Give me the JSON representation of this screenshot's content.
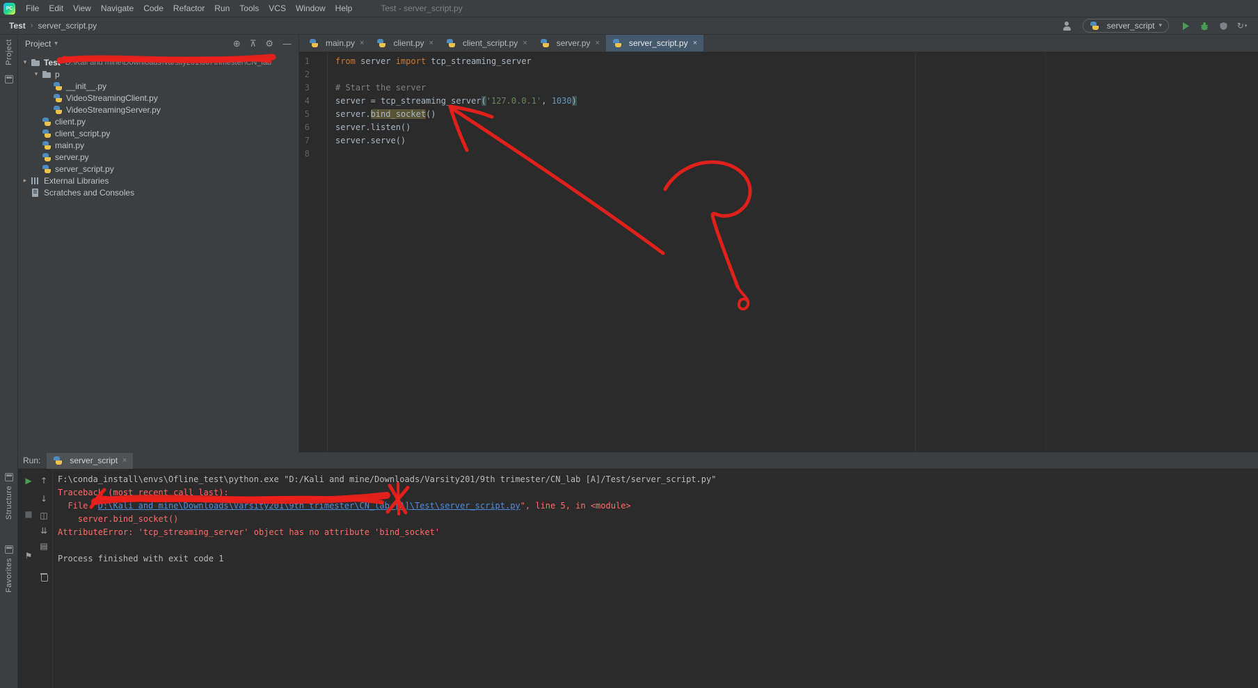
{
  "colors": {
    "annotation_red": "#ed1f1a",
    "panel_bg": "#3c3f41",
    "editor_bg": "#2b2b2b",
    "keyword_orange": "#cc7832",
    "string_green": "#6a8759",
    "number_blue": "#6897bb",
    "comment_gray": "#808080",
    "error_red": "#ff6b68",
    "link_blue": "#4e8ddb",
    "run_green": "#499c54",
    "active_tab_bg": "#45596d"
  },
  "icons": {
    "close": "×",
    "dropdown_caret": "▾",
    "expanded_caret": "▾",
    "collapsed_caret": "▸",
    "locate": "⊕",
    "collapse_all": "⊼",
    "settings_gear": "⚙",
    "hide": "—",
    "rerun": "▶",
    "stop": "■",
    "pin": "⚑",
    "up": "↑",
    "down": "↓",
    "restore_layout": "◫",
    "scroll_end": "⇊",
    "print": "▤",
    "updates": "↻"
  },
  "title_bar": {
    "app_badge": "PC",
    "menus": [
      "File",
      "Edit",
      "View",
      "Navigate",
      "Code",
      "Refactor",
      "Run",
      "Tools",
      "VCS",
      "Window",
      "Help"
    ],
    "window_title": "Test - server_script.py"
  },
  "nav_bar": {
    "breadcrumb_root": "Test",
    "breadcrumb_separator": "›",
    "breadcrumb_file": "server_script.py",
    "run_config": "server_script"
  },
  "stripes": {
    "project": "Project",
    "structure": "Structure",
    "favorites": "Favorites"
  },
  "project_panel": {
    "header_title": "Project",
    "tree": [
      {
        "label": "Test",
        "path": "D:\\Kali and mine\\Downloads\\Varsity201\\9th trimester\\CN_lab [A]\\Test"
      },
      {
        "label": "p"
      },
      {
        "label": "__init__.py"
      },
      {
        "label": "VideoStreamingClient.py"
      },
      {
        "label": "VideoStreamingServer.py"
      },
      {
        "label": "client.py"
      },
      {
        "label": "client_script.py"
      },
      {
        "label": "main.py"
      },
      {
        "label": "server.py"
      },
      {
        "label": "server_script.py"
      },
      {
        "label": "External Libraries"
      },
      {
        "label": "Scratches and Consoles"
      }
    ]
  },
  "editor": {
    "tabs": [
      "main.py",
      "client.py",
      "client_script.py",
      "server.py",
      "server_script.py"
    ],
    "lines": [
      {
        "num": "1",
        "seg": [
          "from",
          " server ",
          "import",
          " tcp_streaming_server"
        ]
      },
      {
        "num": "2",
        "seg": []
      },
      {
        "num": "3",
        "seg": [
          "# Start the server"
        ]
      },
      {
        "num": "4",
        "seg": [
          "server = tcp_streaming_server",
          "(",
          "'127.0.0.1'",
          ", ",
          "1030",
          ")"
        ]
      },
      {
        "num": "5",
        "seg": [
          "server.",
          "bind_socket",
          "()"
        ]
      },
      {
        "num": "6",
        "seg": [
          "server.listen()"
        ]
      },
      {
        "num": "7",
        "seg": [
          "server.serve()"
        ]
      },
      {
        "num": "8",
        "seg": []
      }
    ]
  },
  "run_panel": {
    "run_label": "Run:",
    "tab_label": "server_script",
    "console": [
      {
        "seg": [
          "F:\\conda_install\\envs\\Ofline_test\\python.exe \"D:/Kali and mine/Downloads/Varsity201/9th trimester/CN_lab [A]/Test/server_script.py\""
        ]
      },
      {
        "seg": [
          "Traceback (most recent call last):"
        ]
      },
      {
        "seg": [
          "  File \"",
          "D:\\Kali and mine\\Downloads\\Varsity201\\9th trimester\\CN_lab [A]",
          "\\Test\\server_script.py",
          "\", line 5, in <module>"
        ]
      },
      {
        "seg": [
          "    server.bind_socket()"
        ]
      },
      {
        "seg": [
          "AttributeError: 'tcp_streaming_server' object has no attribute 'bind_socket'"
        ]
      },
      {
        "seg": [
          ""
        ]
      },
      {
        "seg": [
          "Process finished with exit code 1"
        ]
      }
    ]
  }
}
